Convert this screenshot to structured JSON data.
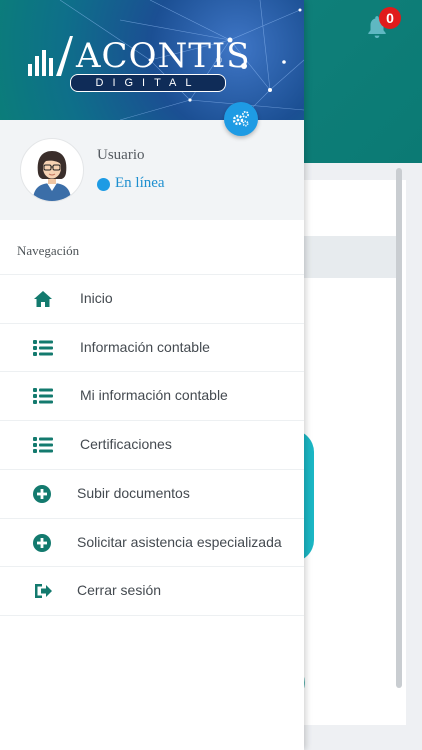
{
  "notifications": {
    "count": "0"
  },
  "brand": {
    "name": "ACONTIS",
    "tm": "®",
    "tagline": "DIGITAL"
  },
  "user": {
    "name": "Usuario",
    "status": "En línea"
  },
  "nav": {
    "title": "Navegación",
    "items": [
      {
        "label": "Inicio",
        "icon": "home-icon"
      },
      {
        "label": "Información contable",
        "icon": "list-icon"
      },
      {
        "label": "Mi información contable",
        "icon": "list-icon"
      },
      {
        "label": "Certificaciones",
        "icon": "list-icon"
      },
      {
        "label": "Subir documentos",
        "icon": "plus-circle-icon"
      },
      {
        "label": "Solicitar asistencia especializada",
        "icon": "plus-circle-icon"
      },
      {
        "label": "Cerrar sesión",
        "icon": "sign-out-icon"
      }
    ]
  },
  "background": {
    "partial_digit": ")"
  },
  "colors": {
    "teal": "#0b7a74",
    "icon": "#137a6e",
    "accent": "#1e9be4",
    "badge": "#e01b1b"
  }
}
